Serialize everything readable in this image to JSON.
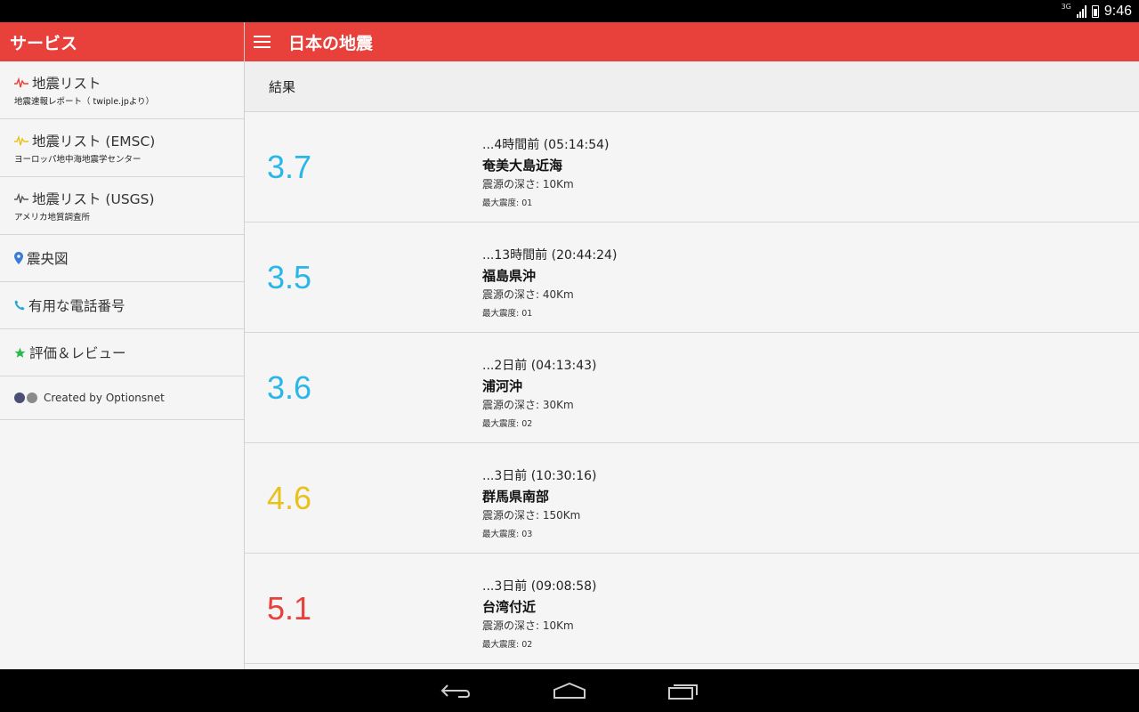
{
  "status_bar": {
    "network": "3G",
    "time": "9:46"
  },
  "drawer": {
    "title": "サービス",
    "items": [
      {
        "label": "地震リスト",
        "sub": "地震速報レポート（ twiple.jpより）",
        "icon": "pulse-icon",
        "icon_color": "#e8403a"
      },
      {
        "label": "地震リスト (EMSC)",
        "sub": "ヨーロッパ地中海地震学センター",
        "icon": "pulse-icon",
        "icon_color": "#e8c21a"
      },
      {
        "label": "地震リスト (USGS)",
        "sub": "アメリカ地質調査所",
        "icon": "pulse-icon",
        "icon_color": "#555555"
      },
      {
        "label": "震央図",
        "icon": "map-pin-icon",
        "icon_color": "#3a7bd5"
      },
      {
        "label": "有用な電話番号",
        "icon": "phone-icon",
        "icon_color": "#2aa6d6"
      },
      {
        "label": "評価＆レビュー",
        "icon": "star-icon",
        "icon_color": "#2fb84f"
      },
      {
        "label": "Created by Optionsnet",
        "icon": "logo-dots-icon"
      }
    ]
  },
  "appbar": {
    "title": "日本の地震"
  },
  "results": {
    "label": "結果",
    "items": [
      {
        "magnitude": "3.7",
        "color": "#29b6e8",
        "time": "...4時間前 (05:14:54)",
        "place": "奄美大島近海",
        "depth": "震源の深さ: 10Km",
        "intensity": "最大震度: 01"
      },
      {
        "magnitude": "3.5",
        "color": "#29b6e8",
        "time": "...13時間前 (20:44:24)",
        "place": "福島県沖",
        "depth": "震源の深さ: 40Km",
        "intensity": "最大震度: 01"
      },
      {
        "magnitude": "3.6",
        "color": "#29b6e8",
        "time": "...2日前 (04:13:43)",
        "place": "浦河沖",
        "depth": "震源の深さ: 30Km",
        "intensity": "最大震度: 02"
      },
      {
        "magnitude": "4.6",
        "color": "#e8c21a",
        "time": "...3日前 (10:30:16)",
        "place": "群馬県南部",
        "depth": "震源の深さ: 150Km",
        "intensity": "最大震度: 03"
      },
      {
        "magnitude": "5.1",
        "color": "#e8403a",
        "time": "...3日前 (09:08:58)",
        "place": "台湾付近",
        "depth": "震源の深さ: 10Km",
        "intensity": "最大震度: 02"
      }
    ]
  },
  "colors": {
    "accent": "#e8403a",
    "background": "#f5f5f5"
  }
}
